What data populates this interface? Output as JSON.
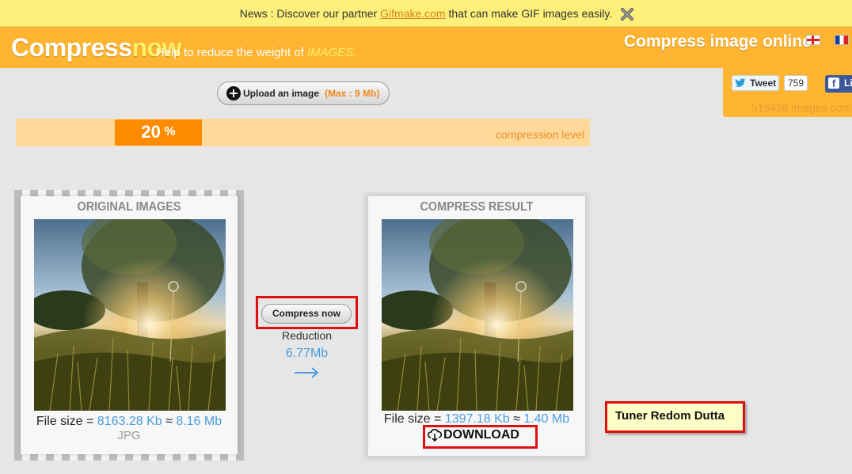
{
  "news": {
    "prefix": "News : Discover our partner ",
    "link_text": "Gifmake.com",
    "suffix": " that can make GIF images easily."
  },
  "header": {
    "logo_part1": "Compress",
    "logo_part2": "now",
    "tagline": "Help to reduce the weight of ",
    "tagline_highlight": "IMAGES.",
    "title": "Compress image online",
    "languages": [
      "English",
      "Français"
    ]
  },
  "social": {
    "tweet_label": "Tweet",
    "tweet_count": "759",
    "facebook_label": "Li",
    "images_count": "515436 images com"
  },
  "upload": {
    "label": "Upload an image",
    "max_note": "(Max : 9 Mb)"
  },
  "compression": {
    "value": "20",
    "unit": "%",
    "label": "compression level",
    "level_fraction": 0.2
  },
  "original": {
    "title": "ORIGINAL IMAGES",
    "size_prefix": "File size = ",
    "size_kb": "8163.28 Kb",
    "approx": " ≈ ",
    "size_mb": "8.16 Mb",
    "format": "JPG"
  },
  "middle": {
    "compress_button": "Compress now",
    "reduction_label": "Reduction",
    "reduction_value": "6.77Mb"
  },
  "result": {
    "title": "COMPRESS RESULT",
    "size_prefix": "File size = ",
    "size_kb": "1397.18 Kb",
    "approx": " ≈ ",
    "size_mb": "1.40 Mb",
    "download_label": "DOWNLOAD"
  },
  "note": {
    "text": "Tuner Redom Dutta"
  },
  "colors": {
    "header_orange": "#ffb532",
    "news_yellow": "#fdf07a",
    "slider_orange": "#ff8c00",
    "link_blue": "#4a9de0",
    "highlight_red": "#e01010"
  }
}
